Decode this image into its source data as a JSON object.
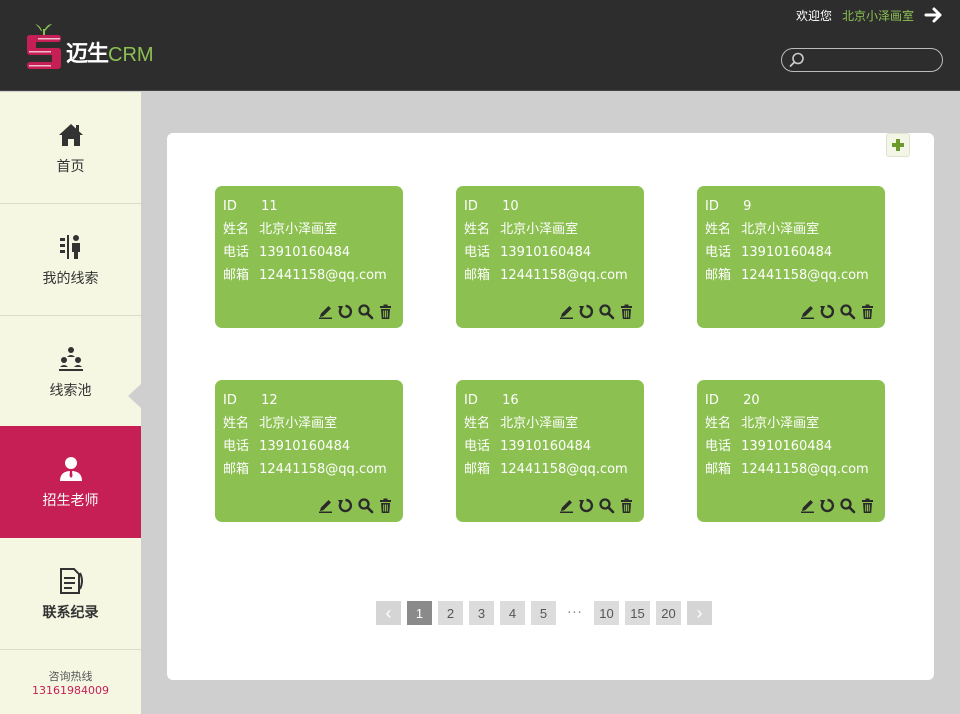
{
  "header": {
    "logo_cn": "迈生",
    "logo_crm": "CRM",
    "welcome_text": "欢迎您",
    "user_name": "北京小泽画室",
    "search_placeholder": ""
  },
  "sidebar": {
    "items": [
      {
        "label": "首页",
        "icon": "home-icon",
        "active": false
      },
      {
        "label": "我的线索",
        "icon": "leads-icon",
        "active": false
      },
      {
        "label": "线索池",
        "icon": "pool-icon",
        "active": false
      },
      {
        "label": "招生老师",
        "icon": "teacher-icon",
        "active": true
      },
      {
        "label": "联系纪录",
        "icon": "records-icon",
        "active": false
      }
    ],
    "hotline_label": "咨询热线",
    "hotline_number": "13161984009"
  },
  "labels": {
    "id": "ID",
    "name": "姓名",
    "phone": "电话",
    "email": "邮箱"
  },
  "cards": [
    {
      "id": "11",
      "name": "北京小泽画室",
      "phone": "13910160484",
      "email": "12441158@qq.com"
    },
    {
      "id": "10",
      "name": "北京小泽画室",
      "phone": "13910160484",
      "email": "12441158@qq.com"
    },
    {
      "id": "9",
      "name": "北京小泽画室",
      "phone": "13910160484",
      "email": "12441158@qq.com"
    },
    {
      "id": "12",
      "name": "北京小泽画室",
      "phone": "13910160484",
      "email": "12441158@qq.com"
    },
    {
      "id": "16",
      "name": "北京小泽画室",
      "phone": "13910160484",
      "email": "12441158@qq.com"
    },
    {
      "id": "20",
      "name": "北京小泽画室",
      "phone": "13910160484",
      "email": "12441158@qq.com"
    }
  ],
  "pagination": {
    "prev": "‹",
    "next": "›",
    "pages_before": [
      "1",
      "2",
      "3",
      "4",
      "5"
    ],
    "ellipsis": "···",
    "pages_after": [
      "10",
      "15",
      "20"
    ],
    "current": "1"
  },
  "colors": {
    "accent_green": "#8cc152",
    "accent_red": "#c51f56",
    "header_bg": "#2d2d2d",
    "sidebar_bg": "#f5f7e3"
  }
}
